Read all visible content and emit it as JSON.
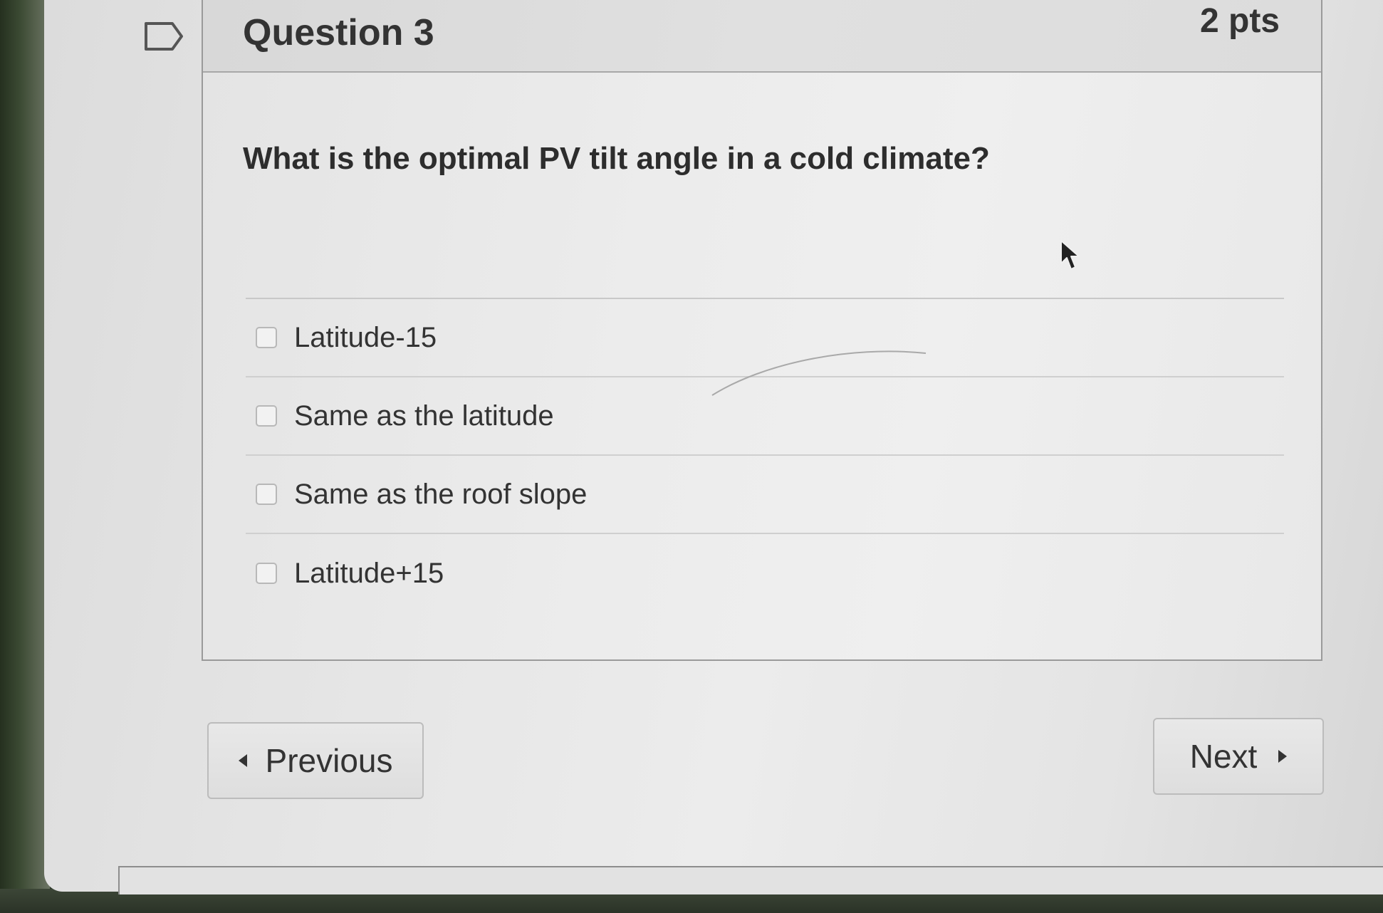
{
  "question": {
    "title": "Question 3",
    "points": "2 pts",
    "text": "What is the optimal PV tilt angle in a cold climate?",
    "answers": [
      {
        "label": "Latitude-15",
        "checked": false
      },
      {
        "label": "Same as the latitude",
        "checked": false
      },
      {
        "label": "Same as the roof slope",
        "checked": false
      },
      {
        "label": "Latitude+15",
        "checked": false
      }
    ]
  },
  "navigation": {
    "previous_label": "Previous",
    "next_label": "Next"
  },
  "icons": {
    "bookmark": "bookmark-icon",
    "prev_arrow": "triangle-left-icon",
    "next_arrow": "triangle-right-icon",
    "cursor": "mouse-pointer-icon"
  },
  "colors": {
    "text": "#333333",
    "panel_border": "#9a9a9a",
    "header_bg": "#dcdcdc"
  }
}
